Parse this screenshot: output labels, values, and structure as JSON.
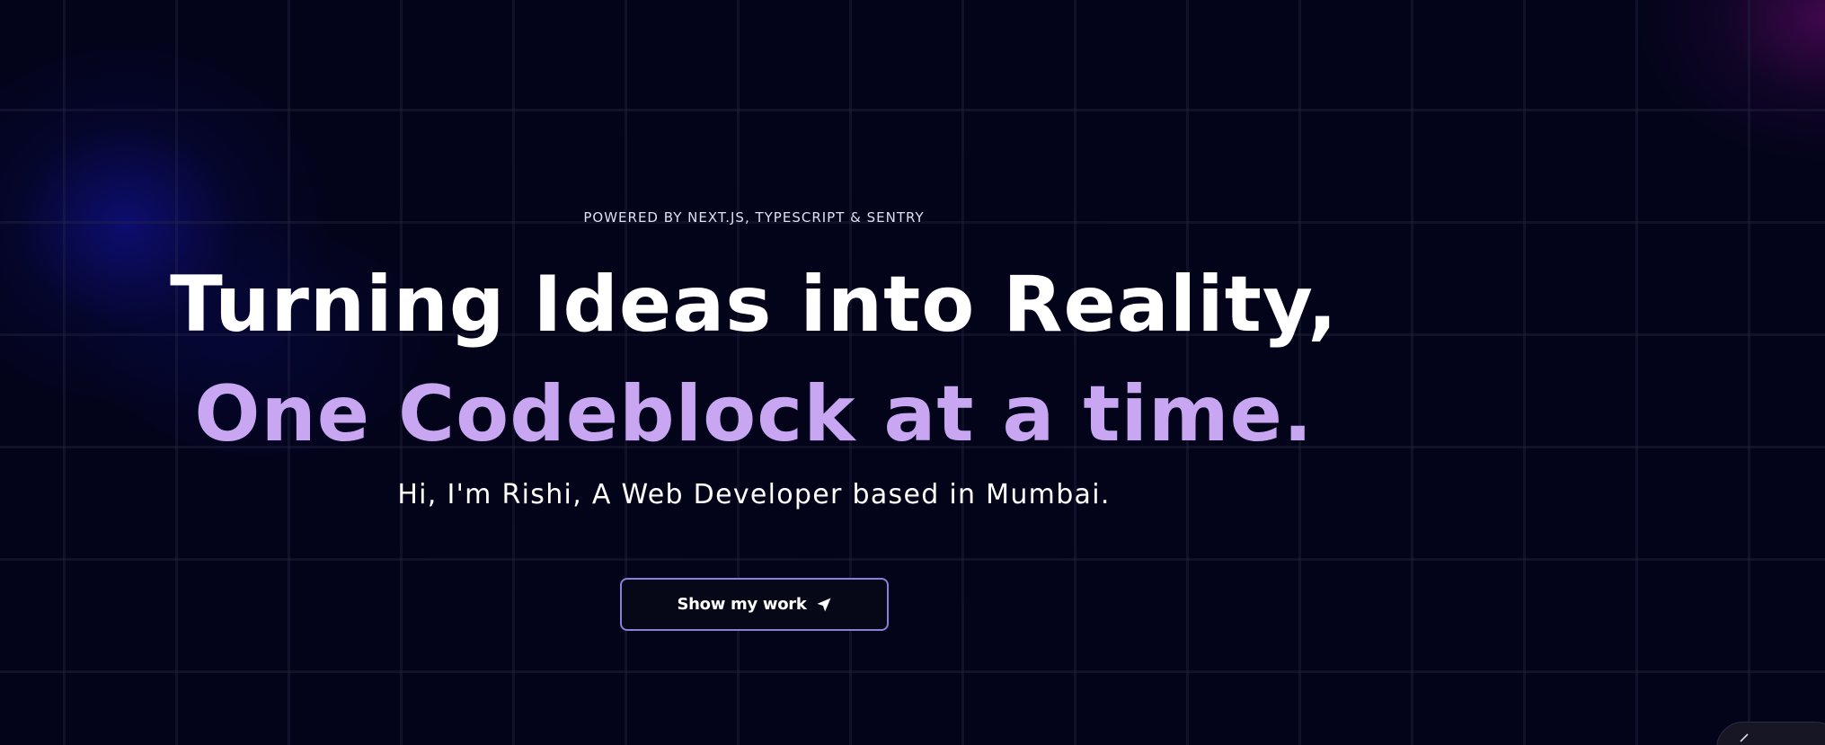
{
  "hero": {
    "eyebrow": "POWERED BY NEXT.JS, TYPESCRIPT & SENTRY",
    "headline_white": "Turning Ideas into Reality,",
    "headline_accent": "One Codeblock at a time.",
    "subtitle": "Hi, I'm Rishi, A Web Developer based in Mumbai.",
    "cta_label": "Show my work",
    "cta_icon": "send-icon"
  },
  "colors": {
    "background": "#03041a",
    "accent": "#c8a6f2",
    "cta_border": "#8a80d8"
  }
}
